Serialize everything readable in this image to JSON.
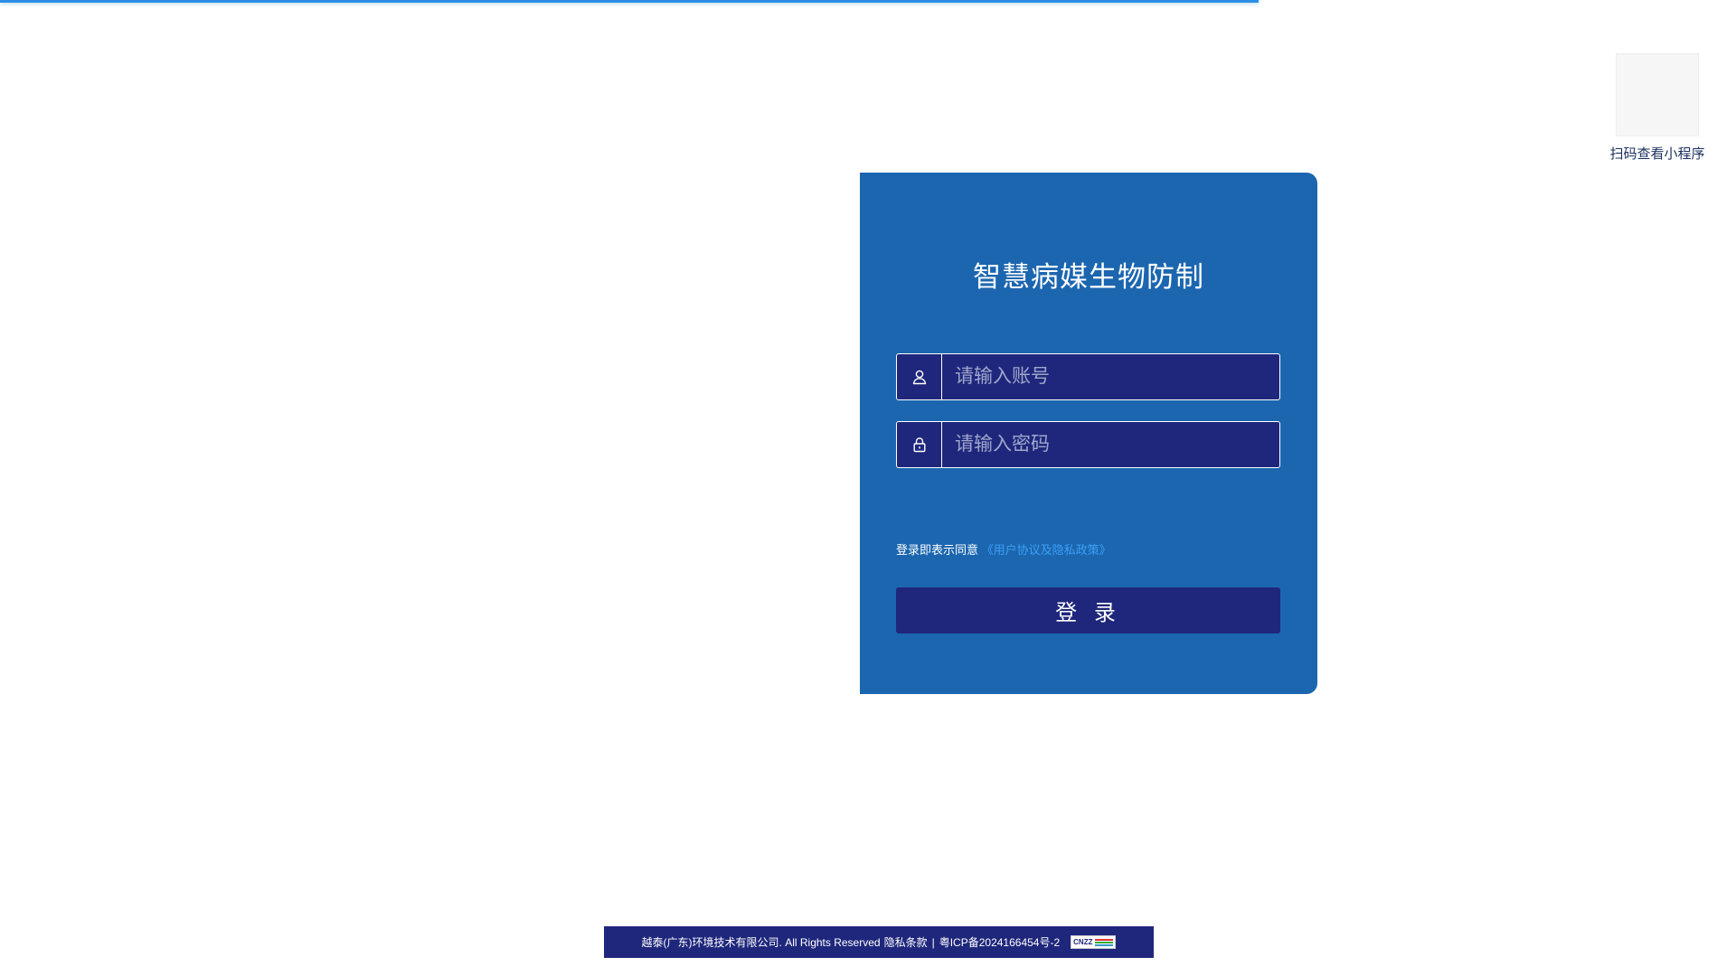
{
  "page": {
    "title": "智慧病媒生物防制"
  },
  "qr": {
    "caption": "扫码查看小程序"
  },
  "login": {
    "account_placeholder": "请输入账号",
    "password_placeholder": "请输入密码",
    "agree_text": "登录即表示同意",
    "agree_link": "《用户协议及隐私政策》",
    "login_button": "登 录",
    "icons": {
      "account": "user-icon",
      "password": "lock-icon"
    }
  },
  "footer": {
    "company": "越泰(广东)环境技术有限公司. All Rights Reserved",
    "privacy": "隐私条款",
    "separator": "|",
    "icp": "粤ICP备2024166454号-2",
    "badge_text": "CNZZ"
  },
  "colors": {
    "card_bg": "#1c66b0",
    "input_bg": "#1f277c",
    "link": "#3aa0f5",
    "progress": "#2a8fe4"
  }
}
